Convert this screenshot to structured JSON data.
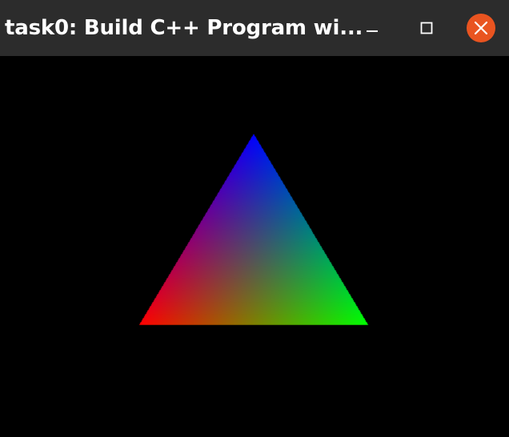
{
  "window": {
    "title": "task0: Build C++ Program wi...",
    "close_color": "#e95420",
    "titlebar_color": "#2c2c2c",
    "background_color": "#000000"
  },
  "controls": {
    "minimize_icon": "minimize-icon",
    "maximize_icon": "maximize-icon",
    "close_icon": "close-icon"
  },
  "triangle": {
    "vertex_colors": {
      "bottom_left": "#ff0000",
      "bottom_right": "#00ff00",
      "top": "#0000ff"
    }
  }
}
